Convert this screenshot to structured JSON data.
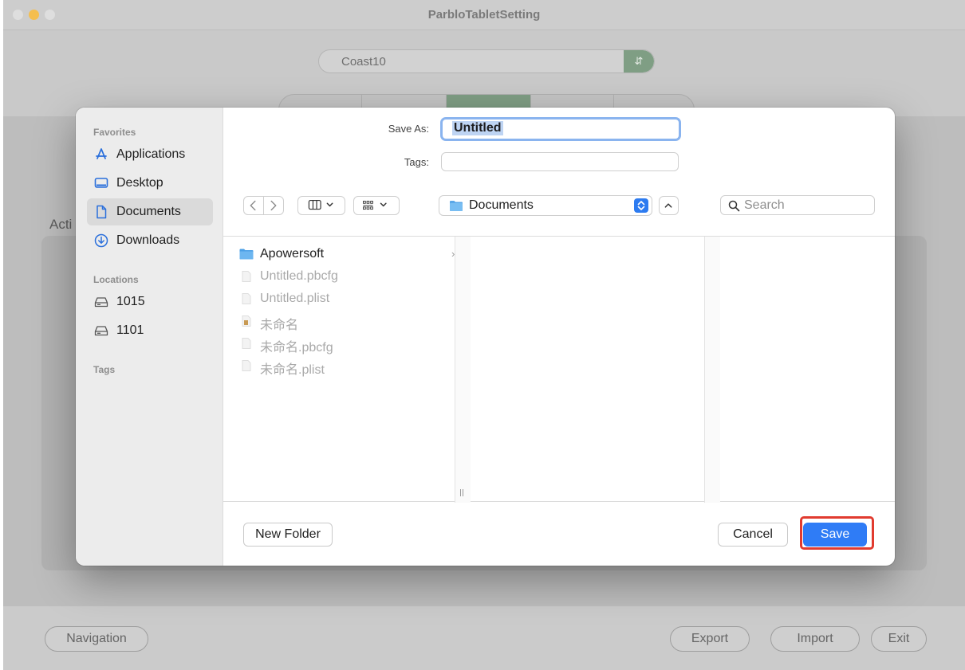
{
  "window": {
    "title": "ParbloTabletSetting"
  },
  "device": {
    "name": "Coast10"
  },
  "section": {
    "label": "Acti"
  },
  "bottom_bar": {
    "navigation": "Navigation",
    "export": "Export",
    "import": "Import",
    "exit": "Exit"
  },
  "dialog": {
    "save_as_label": "Save As:",
    "save_as_value": "Untitled",
    "tags_label": "Tags:",
    "tags_value": "",
    "location": "Documents",
    "search_placeholder": "Search",
    "sidebar": {
      "favorites_header": "Favorites",
      "favorites": [
        {
          "label": "Applications",
          "icon": "applications-icon"
        },
        {
          "label": "Desktop",
          "icon": "desktop-icon"
        },
        {
          "label": "Documents",
          "icon": "document-icon",
          "selected": true
        },
        {
          "label": "Downloads",
          "icon": "downloads-icon"
        }
      ],
      "locations_header": "Locations",
      "locations": [
        {
          "label": "1015",
          "icon": "disk-icon"
        },
        {
          "label": "1101",
          "icon": "disk-icon"
        }
      ],
      "tags_header": "Tags"
    },
    "files": [
      {
        "name": "Apowersoft",
        "type": "folder",
        "enabled": true
      },
      {
        "name": "Untitled.pbcfg",
        "type": "file",
        "enabled": false
      },
      {
        "name": "Untitled.plist",
        "type": "file",
        "enabled": false
      },
      {
        "name": "未命名",
        "type": "app",
        "enabled": false
      },
      {
        "name": "未命名.pbcfg",
        "type": "file",
        "enabled": false
      },
      {
        "name": "未命名.plist",
        "type": "file",
        "enabled": false
      }
    ],
    "new_folder": "New Folder",
    "cancel": "Cancel",
    "save": "Save"
  },
  "colors": {
    "accent": "#2f7cf6",
    "highlight": "#e13b2f",
    "theme_green": "#7f9e84"
  }
}
